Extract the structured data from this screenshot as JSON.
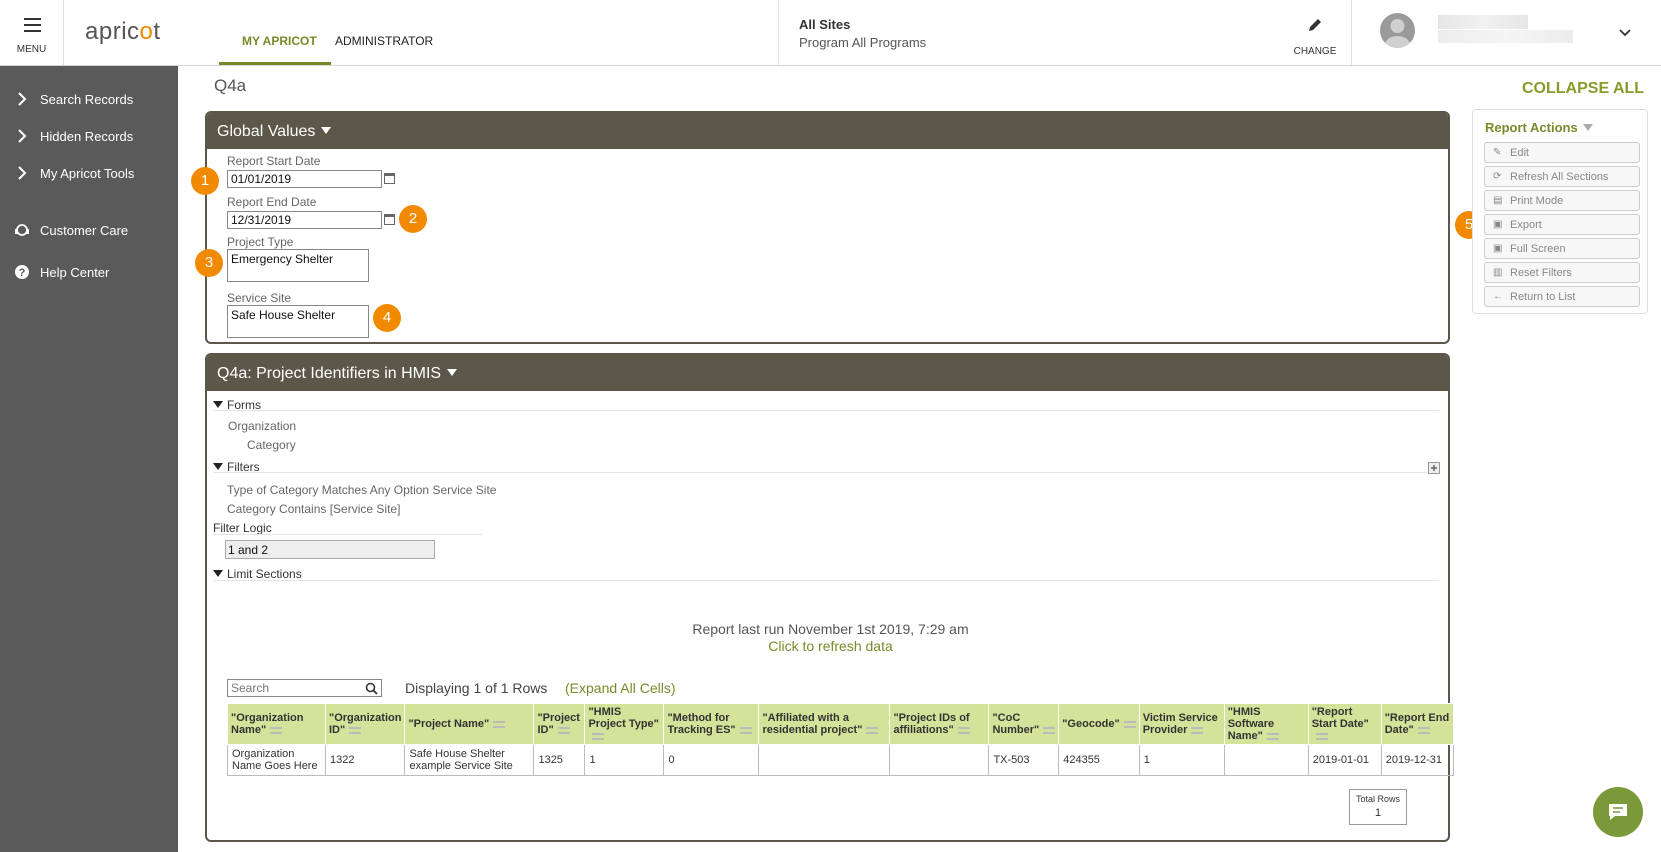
{
  "topbar": {
    "menu_label": "MENU",
    "logo_text_a": "apric",
    "logo_text_dot": "o",
    "logo_text_b": "t",
    "tabs": [
      {
        "label": "MY APRICOT"
      },
      {
        "label": "ADMINISTRATOR"
      }
    ],
    "site_title": "All Sites",
    "site_program": "Program All Programs",
    "change_label": "CHANGE"
  },
  "sidebar": {
    "items": [
      {
        "label": "Search Records",
        "icon": "chevron-right-icon"
      },
      {
        "label": "Hidden Records",
        "icon": "chevron-right-icon"
      },
      {
        "label": "My Apricot Tools",
        "icon": "chevron-right-icon"
      },
      {
        "label": "Customer Care",
        "icon": "headset-icon"
      },
      {
        "label": "Help Center",
        "icon": "help-icon"
      }
    ]
  },
  "page": {
    "title": "Q4a",
    "collapse_all": "COLLAPSE ALL"
  },
  "global_values": {
    "header": "Global Values",
    "start_label": "Report Start Date",
    "start_value": "01/01/2019",
    "end_label": "Report End Date",
    "end_value": "12/31/2019",
    "project_type_label": "Project Type",
    "project_type_value": "Emergency Shelter",
    "service_site_label": "Service Site",
    "service_site_value": "Safe House Shelter"
  },
  "badges": [
    "1",
    "2",
    "3",
    "4",
    "5"
  ],
  "report_actions": {
    "title": "Report Actions",
    "buttons": [
      {
        "label": "Edit",
        "icon": "edit-icon"
      },
      {
        "label": "Refresh All Sections",
        "icon": "refresh-icon"
      },
      {
        "label": "Print Mode",
        "icon": "print-icon"
      },
      {
        "label": "Export",
        "icon": "save-icon"
      },
      {
        "label": "Full Screen",
        "icon": "save-icon"
      },
      {
        "label": "Reset Filters",
        "icon": "trash-icon"
      },
      {
        "label": "Return to List",
        "icon": "back-arrow-icon"
      }
    ]
  },
  "section": {
    "header": "Q4a: Project Identifiers in HMIS",
    "forms_label": "Forms",
    "forms_items": [
      "Organization",
      "Category"
    ],
    "filters_label": "Filters",
    "filters_items": [
      "Type of Category Matches Any Option Service Site",
      "Category Contains [Service Site]"
    ],
    "filter_logic_label": "Filter Logic",
    "filter_logic_value": "1 and 2",
    "limit_label": "Limit Sections",
    "last_run": "Report last run November 1st 2019, 7:29 am",
    "refresh_link": "Click to refresh data",
    "search_placeholder": "Search",
    "displaying": "Displaying 1 of 1 Rows",
    "expand_all": "(Expand All Cells)",
    "total_rows_label": "Total Rows",
    "total_rows_value": "1"
  },
  "table": {
    "columns": [
      "\"Organization Name\"",
      "\"Organization ID\"",
      "\"Project Name\"",
      "\"Project ID\"",
      "\"HMIS Project Type\"",
      "\"Method for Tracking ES\"",
      "\"Affiliated with a residential project\"",
      "\"Project IDs of affiliations\"",
      "\"CoC Number\"",
      "\"Geocode\"",
      "Victim Service Provider",
      "\"HMIS Software Name\"",
      "\"Report Start Date\"",
      "\"Report End Date\""
    ],
    "rows": [
      [
        "Organization Name Goes Here",
        "1322",
        "Safe House Shelter example Service Site",
        "1325",
        "1",
        "0",
        "",
        "",
        "TX-503",
        "424355",
        "1",
        "",
        "2019-01-01",
        "2019-12-31"
      ]
    ]
  }
}
